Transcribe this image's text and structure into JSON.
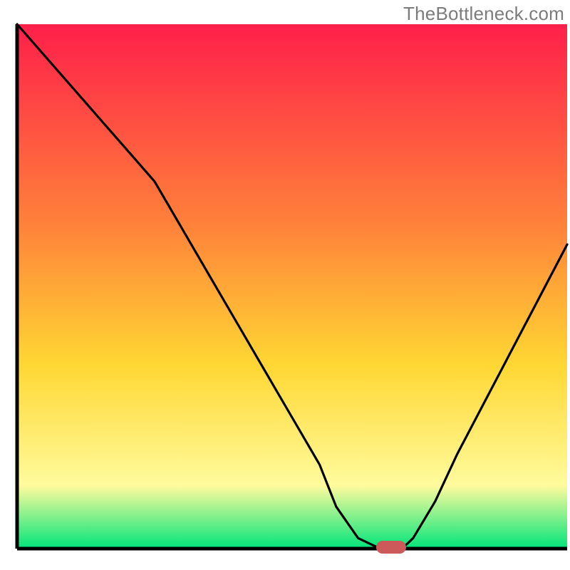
{
  "watermark": "TheBottleneck.com",
  "colors": {
    "gradient_top": "#ff1f4a",
    "gradient_mid1": "#ff813a",
    "gradient_mid2": "#ffd733",
    "gradient_mid3": "#fffb9d",
    "gradient_bottom": "#00e57a",
    "axis": "#000000",
    "curve": "#000000",
    "marker_fill": "#cc5a5a"
  },
  "chart_data": {
    "type": "line",
    "title": "",
    "xlabel": "",
    "ylabel": "",
    "xlim": [
      0,
      100
    ],
    "ylim": [
      0,
      100
    ],
    "x": [
      0,
      5,
      10,
      15,
      20,
      25,
      30,
      35,
      40,
      45,
      50,
      55,
      58,
      62,
      66,
      70,
      72,
      76,
      80,
      85,
      90,
      95,
      100
    ],
    "values": [
      100,
      94,
      88,
      82,
      76,
      70,
      61,
      52,
      43,
      34,
      25,
      16,
      8,
      2,
      0,
      0,
      2,
      9,
      18,
      28,
      38,
      48,
      58
    ],
    "marker": {
      "x": 68,
      "y": 0,
      "shape": "pill"
    },
    "grid": false,
    "legend": false
  }
}
